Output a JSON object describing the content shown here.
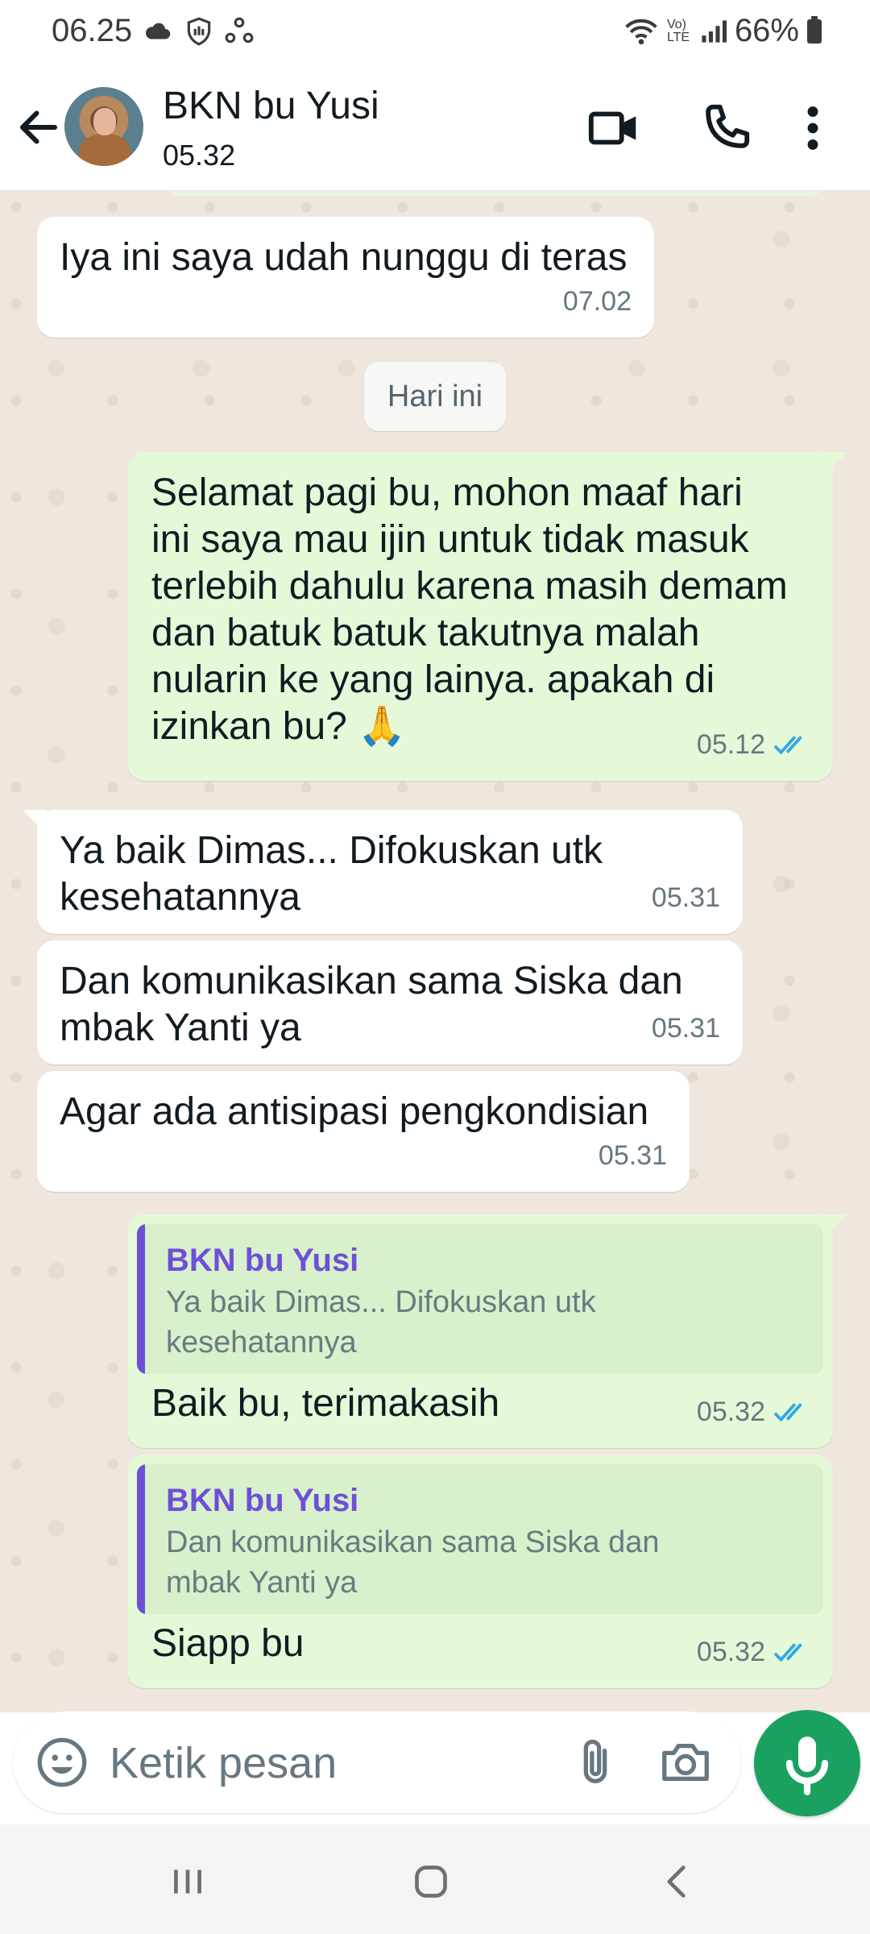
{
  "status_bar": {
    "time": "06.25",
    "network": "Vo) LTE",
    "battery": "66%"
  },
  "header": {
    "contact_name": "BKN bu Yusi",
    "last_seen": "05.32",
    "icons": [
      "back-arrow-icon",
      "video-call-icon",
      "phone-icon",
      "more-vertical-icon"
    ]
  },
  "chat": {
    "date_divider": "Hari ini",
    "messages": [
      {
        "direction": "in",
        "text": "Iya ini saya udah nunggu di teras",
        "time": "07.02"
      },
      {
        "direction": "out",
        "lines": [
          "Selamat pagi bu, mohon maaf hari",
          "ini saya mau ijin untuk tidak masuk",
          "terlebih dahulu karena masih demam",
          "dan batuk batuk takutnya malah",
          "nularin ke yang lainya. apakah di",
          "izinkan bu? 🙏"
        ],
        "time": "05.12",
        "read": true
      },
      {
        "direction": "in",
        "lines": [
          "Ya baik Dimas... Difokuskan utk",
          "kesehatannya"
        ],
        "time": "05.31"
      },
      {
        "direction": "in",
        "lines": [
          "Dan komunikasikan sama Siska dan",
          "mbak Yanti ya"
        ],
        "time": "05.31"
      },
      {
        "direction": "in",
        "text": "Agar ada antisipasi pengkondisian",
        "time": "05.31"
      },
      {
        "direction": "out",
        "quote_name": "BKN bu Yusi",
        "quote_lines": [
          "Ya baik Dimas... Difokuskan utk",
          "kesehatannya"
        ],
        "text": "Baik bu, terimakasih",
        "time": "05.32",
        "read": true
      },
      {
        "direction": "out",
        "quote_name": "BKN bu Yusi",
        "quote_lines": [
          "Dan komunikasikan sama Siska dan",
          "mbak Yanti ya"
        ],
        "text": "Siapp bu",
        "time": "05.32",
        "read": true
      }
    ]
  },
  "composer": {
    "placeholder": "Ketik pesan",
    "icons": [
      "emoji-icon",
      "paperclip-icon",
      "camera-icon",
      "microphone-icon"
    ]
  },
  "colors": {
    "incoming_bubble": "#ffffff",
    "outgoing_bubble": "#e5f9d8",
    "chat_background": "#efe7dd",
    "read_ticks": "#34a8e0",
    "quote_accent": "#6e4fd8",
    "mic_button": "#1aa160"
  }
}
